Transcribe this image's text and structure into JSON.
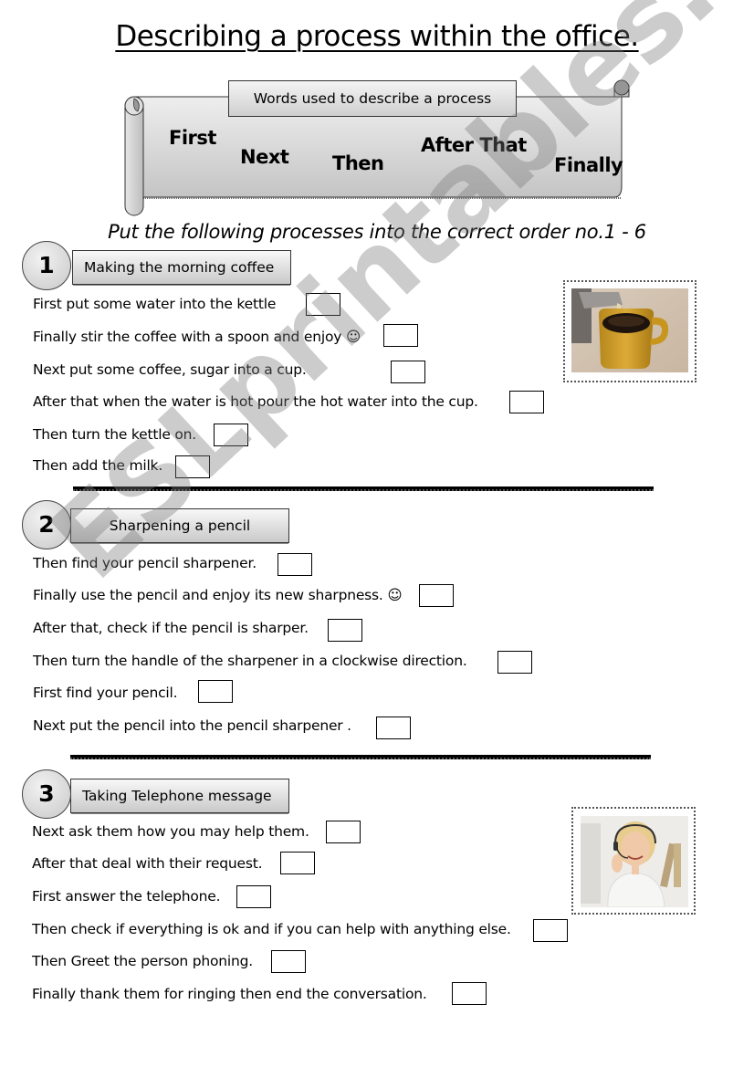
{
  "title": "Describing a process within the office.",
  "word_banner": {
    "header": "Words used to describe a process",
    "words": [
      "First",
      "Next",
      "Then",
      "After That",
      "Finally"
    ]
  },
  "instruction": "Put the following processes into the correct order no.1 - 6",
  "sections": [
    {
      "number": "1",
      "title": "Making the morning coffee",
      "steps": [
        {
          "text": "First put some water into the kettle",
          "answer": ""
        },
        {
          "text": "Finally stir the coffee with a spoon and enjoy ☺",
          "answer": ""
        },
        {
          "text": "Next put some coffee, sugar into a cup.",
          "answer": ""
        },
        {
          "text": "After that when the water is hot pour the hot water into the cup.",
          "answer": ""
        },
        {
          "text": "Then turn the kettle on.",
          "answer": ""
        },
        {
          "text": "Then add the milk.",
          "answer": ""
        }
      ],
      "image": "coffee-pouring-photo"
    },
    {
      "number": "2",
      "title": "Sharpening a pencil",
      "steps": [
        {
          "text": "Then find your pencil sharpener.",
          "answer": ""
        },
        {
          "text": "Finally use the pencil and enjoy its new sharpness. ☺",
          "answer": ""
        },
        {
          "text": "After that, check if the pencil is sharper.",
          "answer": ""
        },
        {
          "text": "Then turn the handle of the sharpener in a clockwise direction.",
          "answer": ""
        },
        {
          "text": "First find your pencil.",
          "answer": ""
        },
        {
          "text": "Next put the pencil into the pencil sharpener .",
          "answer": ""
        }
      ]
    },
    {
      "number": "3",
      "title": "Taking Telephone message",
      "steps": [
        {
          "text": "Next ask them how you may help them.",
          "answer": ""
        },
        {
          "text": "After that deal with their request.",
          "answer": ""
        },
        {
          "text": "First answer the telephone.",
          "answer": ""
        },
        {
          "text": "Then check if everything is ok and if you can help with anything else.",
          "answer": ""
        },
        {
          "text": "Then Greet the person phoning.",
          "answer": ""
        },
        {
          "text": "Finally thank them for ringing then end the conversation.",
          "answer": ""
        }
      ],
      "image": "call-center-woman-photo"
    }
  ],
  "watermark": "ESLprintables.com"
}
